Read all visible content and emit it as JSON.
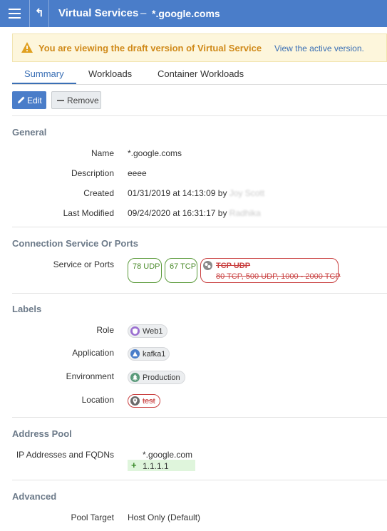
{
  "header": {
    "title": "Virtual Services",
    "separator": "–",
    "subject": "*.google.coms",
    "menu_icon": "hamburger-icon",
    "back_icon": "up-arrow-icon"
  },
  "banner": {
    "message": "You are viewing the draft version of Virtual Service",
    "link": "View the active version.",
    "icon": "warning-icon"
  },
  "tabs": [
    {
      "label": "Summary",
      "active": true
    },
    {
      "label": "Workloads",
      "active": false
    },
    {
      "label": "Container Workloads",
      "active": false
    }
  ],
  "actions": {
    "edit_label": "Edit",
    "remove_label": "Remove"
  },
  "general": {
    "heading": "General",
    "rows": [
      {
        "label": "Name",
        "value": "*.google.coms"
      },
      {
        "label": "Description",
        "value": "eeee"
      },
      {
        "label": "Created",
        "value": "01/31/2019 at 14:13:09 by",
        "user": "Joy Scott"
      },
      {
        "label": "Last Modified",
        "value": "09/24/2020 at 16:31:17 by",
        "user": "Radhika"
      }
    ]
  },
  "connection": {
    "heading": "Connection Service Or Ports",
    "label": "Service or Ports",
    "ports": [
      {
        "text": "78 UDP",
        "status": "added"
      },
      {
        "text": "67 TCP",
        "status": "added"
      }
    ],
    "removed_service": {
      "name": "TCP UDP",
      "detail": "80 TCP, 500 UDP, 1000 - 2000 TCP",
      "status": "removed"
    }
  },
  "labels": {
    "heading": "Labels",
    "rows": [
      {
        "label": "Role",
        "value": "Web1",
        "icon": "shield-icon",
        "color": "#9b6fd0"
      },
      {
        "label": "Application",
        "value": "kafka1",
        "icon": "app-triangle-icon",
        "color": "#4a7dc9"
      },
      {
        "label": "Environment",
        "value": "Production",
        "icon": "tree-icon",
        "color": "#5a9a7a"
      },
      {
        "label": "Location",
        "value": "test",
        "icon": "map-pin-icon",
        "color": "#6b6b6b",
        "status": "removed"
      }
    ]
  },
  "address_pool": {
    "heading": "Address Pool",
    "label": "IP Addresses and FQDNs",
    "existing": "*.google.com",
    "added": "1.1.1.1",
    "added_symbol": "+"
  },
  "advanced": {
    "heading": "Advanced",
    "label": "Pool Target",
    "value": "Host Only (Default)"
  },
  "colors": {
    "header_bg": "#4a7dc9",
    "accent": "#3a6fb5",
    "added": "#4a8a2a",
    "removed": "#c94040",
    "warning_text": "#d08a1a"
  }
}
